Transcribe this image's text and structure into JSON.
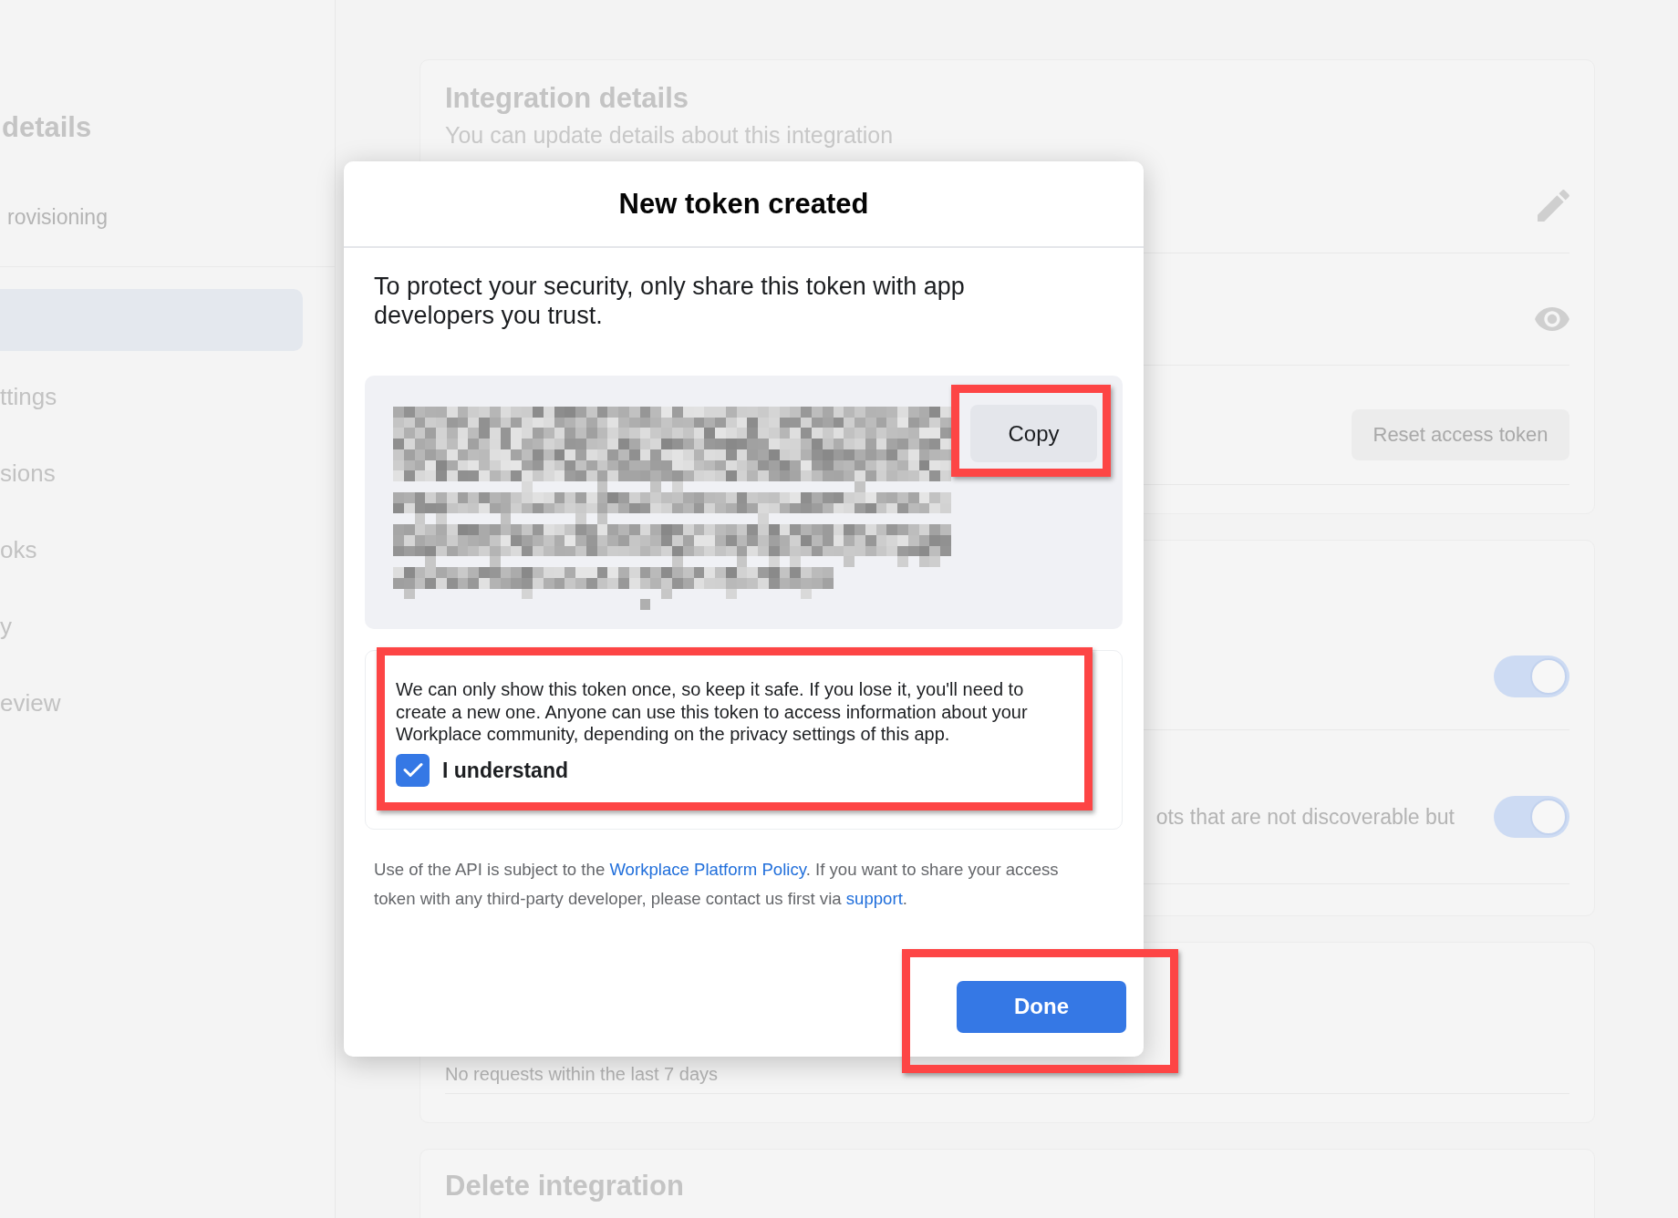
{
  "sidebar": {
    "title": "details",
    "subtitle": "rovisioning",
    "items": [
      {
        "selected": true
      },
      {
        "label": "ttings",
        "selected": false
      },
      {
        "label": "sions",
        "selected": false
      },
      {
        "label": "oks",
        "selected": false
      },
      {
        "label": "y",
        "selected": false
      },
      {
        "label": "eview",
        "selected": false
      }
    ]
  },
  "integration_details": {
    "title": "Integration details",
    "subtitle": "You can update details about this integration",
    "rows": [
      {
        "kind": "edit"
      },
      {
        "kind": "reveal"
      },
      {
        "kind": "action",
        "button": "Reset access token"
      }
    ]
  },
  "settings": {
    "rows": [
      {
        "on": true
      },
      {
        "description": "ots that are not discoverable but",
        "on": true
      }
    ]
  },
  "activity": {
    "text": "No requests within the last 7 days"
  },
  "delete_section": {
    "title": "Delete integration"
  },
  "dialog": {
    "title": "New token created",
    "intro": "To protect your security, only share this token with app developers you trust.",
    "copy_button": {
      "label": "Copy",
      "highlighted": true
    },
    "notice": {
      "text": "We can only show this token once, so keep it safe. If you lose it, you'll need to create a new one. Anyone can use this token to access information about your Workplace community, depending on the privacy settings of this app.",
      "highlighted": true,
      "checkbox": {
        "label": "I understand",
        "checked": true
      }
    },
    "footer": [
      {
        "kind": "text",
        "text": "Use of the API is subject to the "
      },
      {
        "kind": "link",
        "text": "Workplace Platform Policy"
      },
      {
        "kind": "text",
        "text": ". If you want to share your access token with any third-party developer, please contact us first via "
      },
      {
        "kind": "link",
        "text": "support"
      },
      {
        "kind": "text",
        "text": "."
      }
    ],
    "done_button": {
      "label": "Done",
      "highlighted": true
    }
  }
}
